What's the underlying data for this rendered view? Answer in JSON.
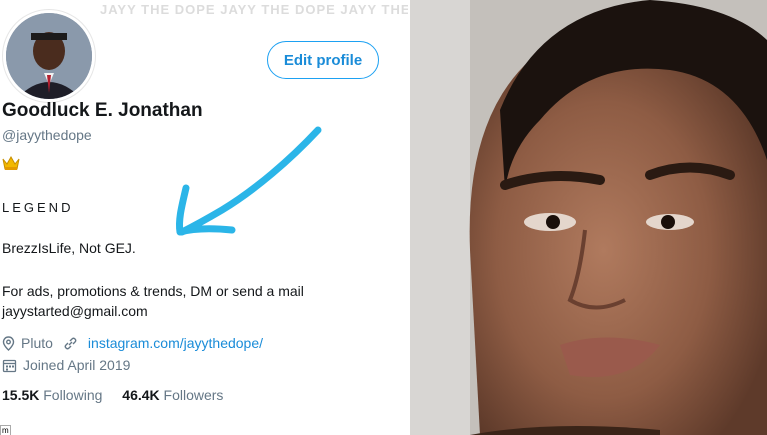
{
  "watermark": "JAYY THE DOPE JAYY THE DOPE JAYY THE DOPE JAYY THE",
  "profile": {
    "edit_button": "Edit profile",
    "name": "Goodluck E. Jonathan",
    "handle": "@jayythedope",
    "badge_icon": "crown-icon",
    "legend": "LEGEND",
    "bio_line1": "BrezzIsLife, Not GEJ.",
    "bio_line2": "For ads, promotions & trends, DM or send a mail",
    "bio_line3": "jayystarted@gmail.com",
    "location": "Pluto",
    "website": "instagram.com/jayythedope/",
    "joined": "Joined April 2019",
    "following_count": "15.5K",
    "following_label": "Following",
    "followers_count": "46.4K",
    "followers_label": "Followers"
  },
  "corner_mark": "m",
  "colors": {
    "accent": "#1da1f2",
    "arrow": "#2bb5e8",
    "text": "#14171a",
    "muted": "#657786"
  }
}
